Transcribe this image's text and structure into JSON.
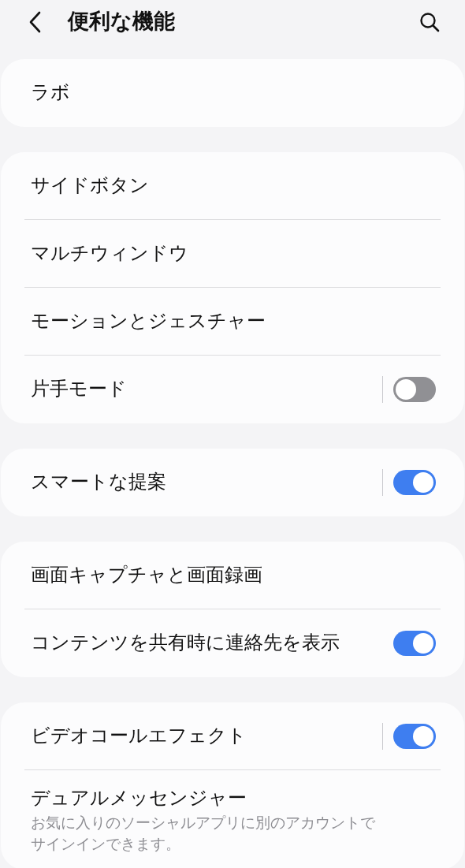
{
  "header": {
    "title": "便利な機能"
  },
  "groups": [
    {
      "rows": [
        {
          "kind": "link",
          "label": "ラボ"
        }
      ]
    },
    {
      "rows": [
        {
          "kind": "link",
          "label": "サイドボタン"
        },
        {
          "kind": "link",
          "label": "マルチウィンドウ"
        },
        {
          "kind": "link",
          "label": "モーションとジェスチャー"
        },
        {
          "kind": "split-switch",
          "label": "片手モード",
          "on": false
        }
      ]
    },
    {
      "rows": [
        {
          "kind": "split-switch",
          "label": "スマートな提案",
          "on": true
        }
      ]
    },
    {
      "rows": [
        {
          "kind": "link",
          "label": "画面キャプチャと画面録画"
        },
        {
          "kind": "switch",
          "label": "コンテンツを共有時に連絡先を表示",
          "on": true
        }
      ]
    },
    {
      "rows": [
        {
          "kind": "split-switch",
          "label": "ビデオコールエフェクト",
          "on": true
        },
        {
          "kind": "link",
          "label": "デュアルメッセンジャー",
          "description": "お気に入りのソーシャルアプリに別のアカウントでサインインできます。"
        }
      ]
    }
  ]
}
